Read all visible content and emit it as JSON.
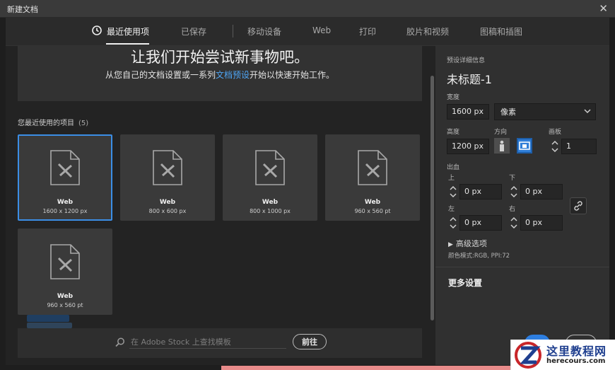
{
  "window": {
    "title": "新建文档"
  },
  "tabs": [
    {
      "label": "最近使用项",
      "active": true
    },
    {
      "label": "已保存"
    },
    {
      "label": "移动设备"
    },
    {
      "label": "Web"
    },
    {
      "label": "打印"
    },
    {
      "label": "胶片和视频"
    },
    {
      "label": "图稿和插图"
    }
  ],
  "hero": {
    "title": "让我们开始尝试新事物吧。",
    "subtitle_before": "从您自己的文档设置或一系列",
    "subtitle_link": "文档预设",
    "subtitle_after": "开始以快速开始工作。"
  },
  "recent": {
    "label": "您最近使用的项目",
    "count": "(5)",
    "items": [
      {
        "name": "Web",
        "size": "1600 x 1200 px",
        "selected": true
      },
      {
        "name": "Web",
        "size": "800 x 600 px"
      },
      {
        "name": "Web",
        "size": "800 x 1000 px"
      },
      {
        "name": "Web",
        "size": "960 x 560 pt"
      },
      {
        "name": "Web",
        "size": "960 x 560 pt"
      }
    ]
  },
  "stock": {
    "placeholder": "在 Adobe Stock 上查找模板",
    "go_label": "前往"
  },
  "details": {
    "section_label": "预设详细信息",
    "doc_name": "未标题-1",
    "width_label": "宽度",
    "width_value": "1600 px",
    "unit_value": "像素",
    "height_label": "高度",
    "height_value": "1200 px",
    "orientation_label": "方向",
    "artboards_label": "画板",
    "artboards_value": "1",
    "bleed_label": "出血",
    "bleed_top_label": "上",
    "bleed_top_value": "0 px",
    "bleed_bottom_label": "下",
    "bleed_bottom_value": "0 px",
    "bleed_left_label": "左",
    "bleed_left_value": "0 px",
    "bleed_right_label": "右",
    "bleed_right_value": "0 px",
    "advanced_label": "高级选项",
    "color_mode": "颜色模式:RGB, PPI:72",
    "more_settings": "更多设置"
  },
  "watermark": {
    "name": "这里教程网",
    "domain": "herecours.com"
  },
  "colors": {
    "accent": "#3b8ee6",
    "link": "#4ea5f5",
    "panel": "#303030",
    "background": "#1e1e1e"
  }
}
